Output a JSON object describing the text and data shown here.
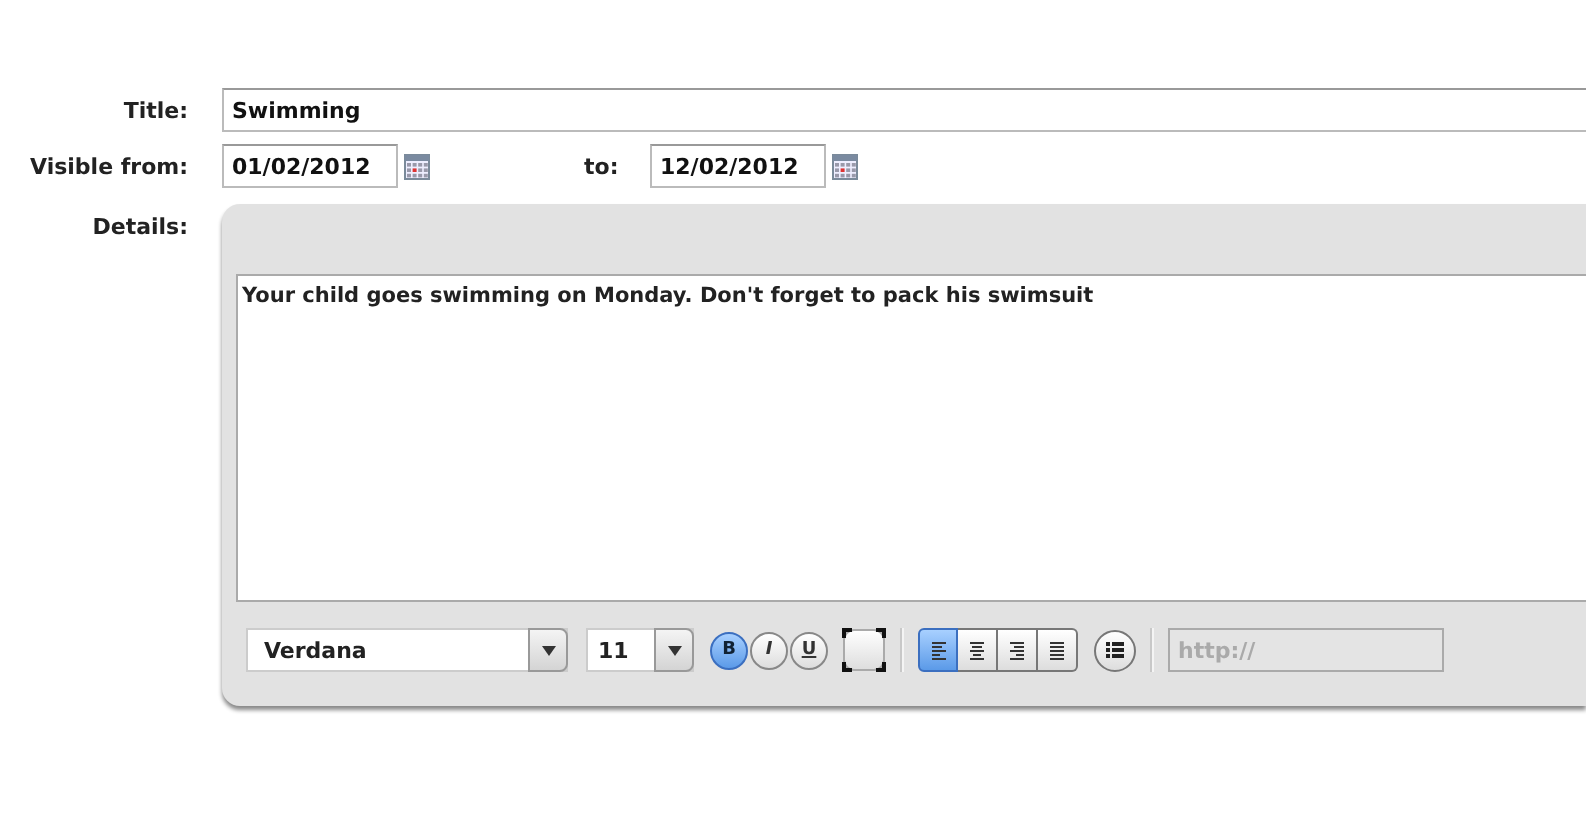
{
  "title_field": {
    "label": "Title:",
    "value": "Swimming"
  },
  "visible": {
    "from_label": "Visible from:",
    "from_value": "01/02/2012",
    "to_label": "to:",
    "to_value": "12/02/2012"
  },
  "details": {
    "label": "Details:",
    "text": "Your child goes swimming on Monday. Don't forget to pack his swimsuit"
  },
  "toolbar": {
    "font": "Verdana",
    "size": "11",
    "styles": [
      {
        "label": "B",
        "kind": "bold",
        "selected": true
      },
      {
        "label": "I",
        "kind": "italic",
        "selected": false
      },
      {
        "label": "U",
        "kind": "underline",
        "selected": false
      }
    ],
    "align": [
      {
        "kind": "left",
        "selected": true
      },
      {
        "kind": "center",
        "selected": false
      },
      {
        "kind": "right",
        "selected": false
      },
      {
        "kind": "justify",
        "selected": false
      }
    ],
    "link": {
      "placeholder": "http://",
      "disabled": true
    }
  }
}
